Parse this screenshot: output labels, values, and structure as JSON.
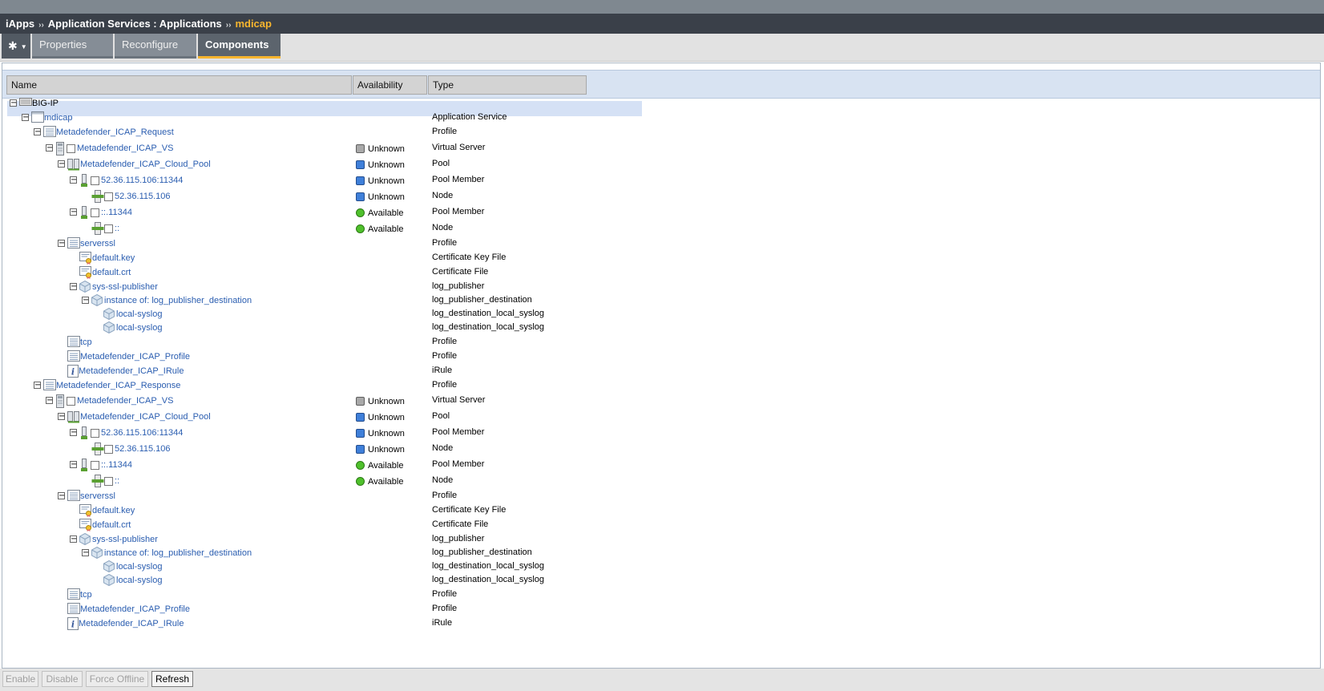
{
  "breadcrumb": {
    "part1": "iApps",
    "sep1": "››",
    "part2": "Application Services : Applications",
    "sep2": "››",
    "current": "mdicap"
  },
  "tabs": {
    "properties": "Properties",
    "reconfigure": "Reconfigure",
    "components": "Components"
  },
  "columns": {
    "name": "Name",
    "availability": "Availability",
    "type": "Type"
  },
  "tree": [
    {
      "depth": 0,
      "toggle": "minus",
      "icon": "server",
      "name": "BIG-IP",
      "root": true,
      "type": ""
    },
    {
      "depth": 1,
      "toggle": "minus",
      "icon": "app",
      "name": "mdicap",
      "type": "Application Service"
    },
    {
      "depth": 2,
      "toggle": "minus",
      "icon": "profile",
      "name": "Metadefender_ICAP_Request",
      "type": "Profile"
    },
    {
      "depth": 3,
      "toggle": "minus",
      "icon": "vs",
      "check": true,
      "name": "Metadefender_ICAP_VS",
      "status": "gray",
      "avail": "Unknown",
      "type": "Virtual Server"
    },
    {
      "depth": 4,
      "toggle": "minus",
      "icon": "pool",
      "name": "Metadefender_ICAP_Cloud_Pool",
      "status": "blue",
      "avail": "Unknown",
      "type": "Pool"
    },
    {
      "depth": 5,
      "toggle": "minus",
      "icon": "member",
      "check": true,
      "name": "52.36.115.106:11344",
      "status": "blue",
      "avail": "Unknown",
      "type": "Pool Member"
    },
    {
      "depth": 6,
      "icon": "node",
      "check": true,
      "name": "52.36.115.106",
      "status": "blue",
      "avail": "Unknown",
      "type": "Node"
    },
    {
      "depth": 5,
      "toggle": "minus",
      "icon": "member",
      "check": true,
      "name": "::.11344",
      "status": "green",
      "avail": "Available",
      "type": "Pool Member"
    },
    {
      "depth": 6,
      "icon": "node",
      "check": true,
      "name": "::",
      "status": "green",
      "avail": "Available",
      "type": "Node"
    },
    {
      "depth": 4,
      "toggle": "minus",
      "icon": "profile",
      "name": "serverssl",
      "type": "Profile"
    },
    {
      "depth": 5,
      "icon": "cert",
      "name": "default.key",
      "type": "Certificate Key File"
    },
    {
      "depth": 5,
      "icon": "cert",
      "name": "default.crt",
      "type": "Certificate File"
    },
    {
      "depth": 5,
      "toggle": "minus",
      "icon": "cube",
      "name": "sys-ssl-publisher",
      "type": "log_publisher"
    },
    {
      "depth": 6,
      "toggle": "minus",
      "icon": "cube",
      "name": "instance of: log_publisher_destination",
      "type": "log_publisher_destination"
    },
    {
      "depth": 7,
      "icon": "cube",
      "name": "local-syslog",
      "type": "log_destination_local_syslog"
    },
    {
      "depth": 7,
      "icon": "cube",
      "name": "local-syslog",
      "type": "log_destination_local_syslog"
    },
    {
      "depth": 4,
      "icon": "profile",
      "name": "tcp",
      "type": "Profile"
    },
    {
      "depth": 4,
      "icon": "profile",
      "name": "Metadefender_ICAP_Profile",
      "type": "Profile"
    },
    {
      "depth": 4,
      "icon": "irule",
      "name": "Metadefender_ICAP_IRule",
      "type": "iRule"
    },
    {
      "depth": 2,
      "toggle": "minus",
      "icon": "profile",
      "name": "Metadefender_ICAP_Response",
      "type": "Profile"
    },
    {
      "depth": 3,
      "toggle": "minus",
      "icon": "vs",
      "check": true,
      "name": "Metadefender_ICAP_VS",
      "status": "gray",
      "avail": "Unknown",
      "type": "Virtual Server"
    },
    {
      "depth": 4,
      "toggle": "minus",
      "icon": "pool",
      "name": "Metadefender_ICAP_Cloud_Pool",
      "status": "blue",
      "avail": "Unknown",
      "type": "Pool"
    },
    {
      "depth": 5,
      "toggle": "minus",
      "icon": "member",
      "check": true,
      "name": "52.36.115.106:11344",
      "status": "blue",
      "avail": "Unknown",
      "type": "Pool Member"
    },
    {
      "depth": 6,
      "icon": "node",
      "check": true,
      "name": "52.36.115.106",
      "status": "blue",
      "avail": "Unknown",
      "type": "Node"
    },
    {
      "depth": 5,
      "toggle": "minus",
      "icon": "member",
      "check": true,
      "name": "::.11344",
      "status": "green",
      "avail": "Available",
      "type": "Pool Member"
    },
    {
      "depth": 6,
      "icon": "node",
      "check": true,
      "name": "::",
      "status": "green",
      "avail": "Available",
      "type": "Node"
    },
    {
      "depth": 4,
      "toggle": "minus",
      "icon": "profile",
      "name": "serverssl",
      "type": "Profile"
    },
    {
      "depth": 5,
      "icon": "cert",
      "name": "default.key",
      "type": "Certificate Key File"
    },
    {
      "depth": 5,
      "icon": "cert",
      "name": "default.crt",
      "type": "Certificate File"
    },
    {
      "depth": 5,
      "toggle": "minus",
      "icon": "cube",
      "name": "sys-ssl-publisher",
      "type": "log_publisher"
    },
    {
      "depth": 6,
      "toggle": "minus",
      "icon": "cube",
      "name": "instance of: log_publisher_destination",
      "type": "log_publisher_destination"
    },
    {
      "depth": 7,
      "icon": "cube",
      "name": "local-syslog",
      "type": "log_destination_local_syslog"
    },
    {
      "depth": 7,
      "icon": "cube",
      "name": "local-syslog",
      "type": "log_destination_local_syslog"
    },
    {
      "depth": 4,
      "icon": "profile",
      "name": "tcp",
      "type": "Profile"
    },
    {
      "depth": 4,
      "icon": "profile",
      "name": "Metadefender_ICAP_Profile",
      "type": "Profile"
    },
    {
      "depth": 4,
      "icon": "irule",
      "name": "Metadefender_ICAP_IRule",
      "type": "iRule"
    }
  ],
  "buttons": {
    "enable": "Enable",
    "disable": "Disable",
    "force_offline": "Force Offline",
    "refresh": "Refresh"
  },
  "colors": {
    "accent": "#f7b52e",
    "link": "#2a5db0",
    "status_unknown_gray": "#a9a9a9",
    "status_unknown_blue": "#3f7fd9",
    "status_available": "#4fc02c"
  }
}
